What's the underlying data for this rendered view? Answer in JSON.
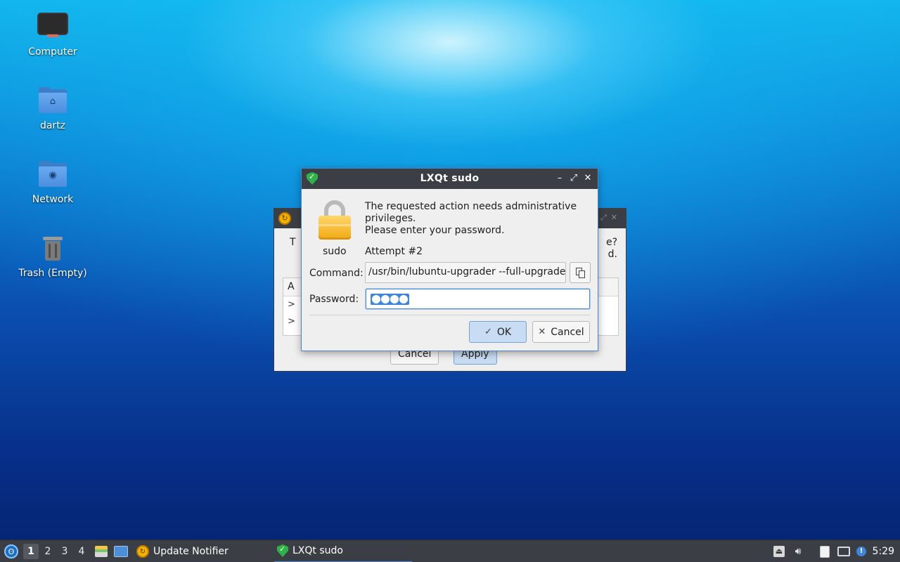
{
  "desktop": {
    "icons": [
      {
        "label": "Computer"
      },
      {
        "label": "dartz"
      },
      {
        "label": "Network"
      },
      {
        "label": "Trash (Empty)"
      }
    ]
  },
  "background_dialog": {
    "text_left": "T",
    "text_right_1": "e?",
    "text_right_2": "d.",
    "table_header": "A",
    "rows": [
      ">",
      ">"
    ],
    "cancel_label": "Cancel",
    "apply_label": "Apply"
  },
  "sudo_dialog": {
    "title": "LXQt sudo",
    "controls": {
      "minimize": "–",
      "maximize": "⤢",
      "close": "✕"
    },
    "message": "The requested action needs administrative privileges.\nPlease enter your password.",
    "app_label": "sudo",
    "attempt": "Attempt #2",
    "command_label": "Command:",
    "command_value": "/usr/bin/lubuntu-upgrader --full-upgrade",
    "password_label": "Password:",
    "password_length": 4,
    "ok_label": "OK",
    "cancel_label": "Cancel"
  },
  "taskbar": {
    "desktops": [
      "1",
      "2",
      "3",
      "4"
    ],
    "active_desktop": "1",
    "tasks": [
      {
        "label": "Update Notifier",
        "active": false
      },
      {
        "label": "LXQt sudo",
        "active": true
      }
    ],
    "clock": "5:29"
  }
}
